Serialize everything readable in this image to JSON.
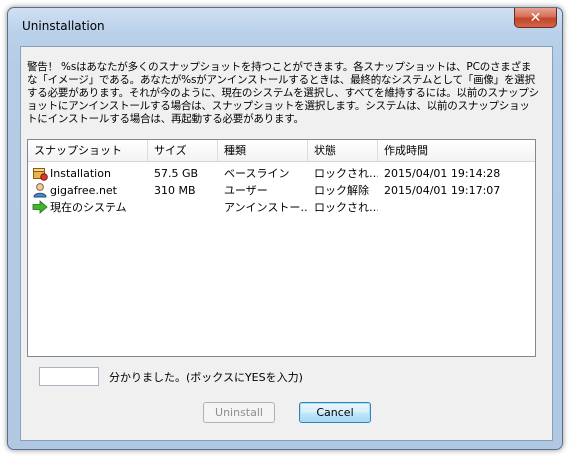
{
  "window": {
    "title": "Uninstallation",
    "close_glyph": "✕"
  },
  "warning_text": "警告！ %sはあなたが多くのスナップショットを持つことができます。各スナップショットは、PCのさまざまな「イメージ」である。あなたが%sがアンインストールするときは、最終的なシステムとして「画像」を選択する必要があります。それが今のように、現在のシステムを選択し、すべてを維持するには。以前のスナップショットにアンインストールする場合は、スナップショットを選択します。システムは、以前のスナップショットにインストールする場合は、再起動する必要があります。",
  "list": {
    "columns": [
      "スナップショット",
      "サイズ",
      "種類",
      "状態",
      "作成時間"
    ],
    "rows": [
      {
        "icon": "installer-box-icon",
        "name": "Installation",
        "size": "57.5 GB",
        "type": "ベースライン",
        "status": "ロックされ…",
        "created": "2015/04/01 19:14:28"
      },
      {
        "icon": "user-icon",
        "name": "gigafree.net",
        "size": "310 MB",
        "type": "ユーザー",
        "status": "ロック解除",
        "created": "2015/04/01 19:17:07"
      },
      {
        "icon": "green-arrow-icon",
        "name": "現在のシステム",
        "size": "",
        "type": "アンインストー…",
        "status": "ロックされ…",
        "created": ""
      }
    ]
  },
  "confirm": {
    "input_value": "",
    "label": "分かりました。(ボックスにYESを入力)"
  },
  "buttons": {
    "uninstall": "Uninstall",
    "cancel": "Cancel"
  }
}
